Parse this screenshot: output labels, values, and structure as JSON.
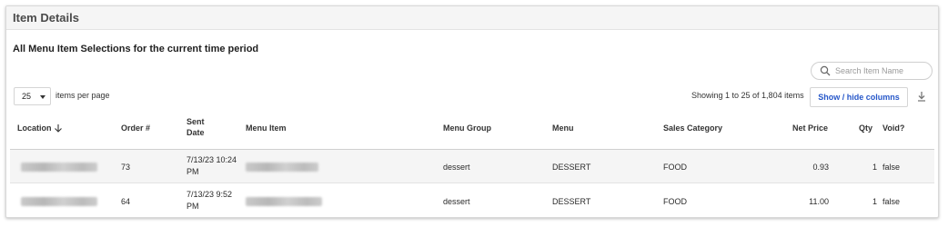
{
  "card": {
    "title": "Item Details",
    "section_title": "All Menu Item Selections for the current time period"
  },
  "search": {
    "placeholder": "Search Item Name",
    "value": "",
    "icon": "search-icon"
  },
  "pagination": {
    "per_page_value": "25",
    "per_page_label": "items per page",
    "showing_text": "Showing 1 to 25 of 1,804 items"
  },
  "toolbar": {
    "show_hide_label": "Show / hide columns",
    "download_icon": "download-icon"
  },
  "table": {
    "columns": {
      "location": "Location",
      "order": "Order #",
      "sent_date_line1": "Sent",
      "sent_date_line2": "Date",
      "menu_item": "Menu Item",
      "menu_group": "Menu Group",
      "menu": "Menu",
      "sales_category": "Sales Category",
      "net_price": "Net Price",
      "qty": "Qty",
      "void": "Void?"
    },
    "rows": [
      {
        "location": "",
        "order": "73",
        "sent_date_line1": "7/13/23 10:24",
        "sent_date_line2": "PM",
        "menu_item": "",
        "menu_group": "dessert",
        "menu": "DESSERT",
        "sales_category": "FOOD",
        "net_price": "0.93",
        "qty": "1",
        "void": "false"
      },
      {
        "location": "",
        "order": "64",
        "sent_date_line1": "7/13/23 9:52",
        "sent_date_line2": "PM",
        "menu_item": "",
        "menu_group": "dessert",
        "menu": "DESSERT",
        "sales_category": "FOOD",
        "net_price": "11.00",
        "qty": "1",
        "void": "false"
      }
    ]
  },
  "colors": {
    "accent": "#2657c9",
    "header_bg": "#f5f5f5",
    "row_alt": "#f5f5f5"
  }
}
